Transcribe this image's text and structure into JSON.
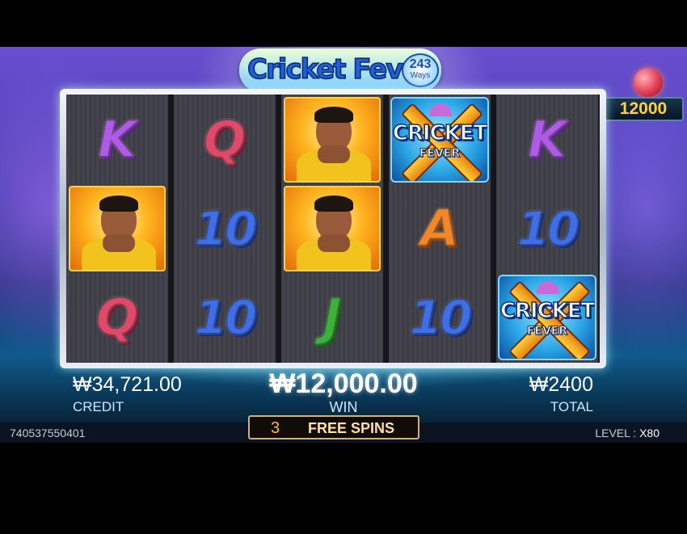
{
  "game": {
    "logo_title": "Cricket Fever",
    "logo_ways_number": "243",
    "logo_ways_label": "Ways",
    "jackpot_value": "12000"
  },
  "reels": [
    [
      "K",
      "cricket-player",
      "Q"
    ],
    [
      "Q",
      "10",
      "10"
    ],
    [
      "cricket-player",
      "cricket-player",
      "J"
    ],
    [
      "wild",
      "A",
      "10"
    ],
    [
      "K",
      "10",
      "wild"
    ]
  ],
  "wild_symbol": {
    "line1": "CRICKET",
    "line2": "FEVER"
  },
  "hud": {
    "credit_value": "₩34,721.00",
    "credit_label": "CREDIT",
    "win_value": "₩12,000.00",
    "win_label": "WIN",
    "total_value": "₩2400",
    "total_label": "TOTAL",
    "free_spins_count": "3",
    "free_spins_label": "FREE SPINS",
    "game_id": "740537550401",
    "level_label": "LEVEL :",
    "level_value": "X80"
  },
  "colors": {
    "jackpot_text": "#ffd23a",
    "free_spins_border": "#d2b07a",
    "accent_glow": "#78e6ff"
  }
}
